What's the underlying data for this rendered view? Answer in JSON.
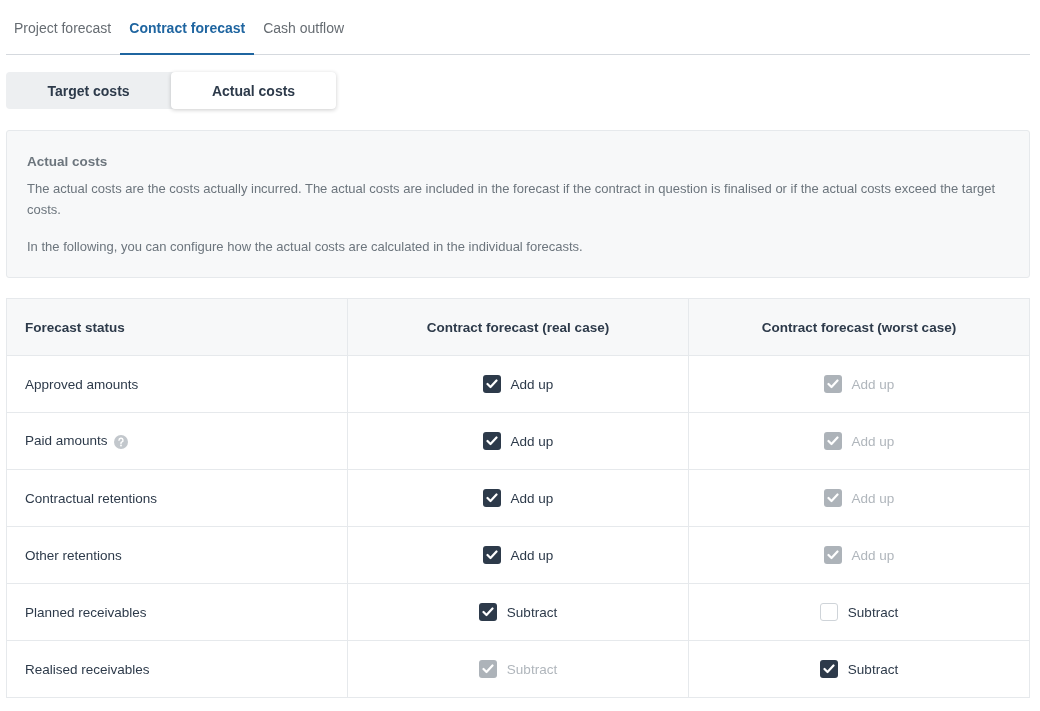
{
  "tabs": [
    {
      "label": "Project forecast",
      "selected": false
    },
    {
      "label": "Contract forecast",
      "selected": true
    },
    {
      "label": "Cash outflow",
      "selected": false
    }
  ],
  "segments": [
    {
      "label": "Target costs",
      "selected": false
    },
    {
      "label": "Actual costs",
      "selected": true
    }
  ],
  "info": {
    "title": "Actual costs",
    "paragraphs": [
      "The actual costs are the costs actually incurred. The actual costs are included in the forecast if the contract in question is finalised or if the actual costs exceed the target costs.",
      "In the following, you can configure how the actual costs are calculated in the individual forecasts."
    ]
  },
  "table": {
    "columns": [
      "Forecast status",
      "Contract forecast (real case)",
      "Contract forecast (worst case)"
    ],
    "rows": [
      {
        "cells": [
          {
            "kind": "status",
            "label": "Approved amounts",
            "help": false
          },
          {
            "kind": "checkbox",
            "label": "Add up",
            "checked": true,
            "disabled": false
          },
          {
            "kind": "checkbox",
            "label": "Add up",
            "checked": true,
            "disabled": true
          }
        ]
      },
      {
        "cells": [
          {
            "kind": "status",
            "label": "Paid amounts",
            "help": true
          },
          {
            "kind": "checkbox",
            "label": "Add up",
            "checked": true,
            "disabled": false
          },
          {
            "kind": "checkbox",
            "label": "Add up",
            "checked": true,
            "disabled": true
          }
        ]
      },
      {
        "cells": [
          {
            "kind": "status",
            "label": "Contractual retentions",
            "help": false
          },
          {
            "kind": "checkbox",
            "label": "Add up",
            "checked": true,
            "disabled": false
          },
          {
            "kind": "checkbox",
            "label": "Add up",
            "checked": true,
            "disabled": true
          }
        ]
      },
      {
        "cells": [
          {
            "kind": "status",
            "label": "Other retentions",
            "help": false
          },
          {
            "kind": "checkbox",
            "label": "Add up",
            "checked": true,
            "disabled": false
          },
          {
            "kind": "checkbox",
            "label": "Add up",
            "checked": true,
            "disabled": true
          }
        ]
      },
      {
        "cells": [
          {
            "kind": "status",
            "label": "Planned receivables",
            "help": false
          },
          {
            "kind": "checkbox",
            "label": "Subtract",
            "checked": true,
            "disabled": false
          },
          {
            "kind": "checkbox",
            "label": "Subtract",
            "checked": false,
            "disabled": false
          }
        ]
      },
      {
        "cells": [
          {
            "kind": "status",
            "label": "Realised receivables",
            "help": false
          },
          {
            "kind": "checkbox",
            "label": "Subtract",
            "checked": true,
            "disabled": true
          },
          {
            "kind": "checkbox",
            "label": "Subtract",
            "checked": true,
            "disabled": false
          }
        ]
      }
    ]
  }
}
